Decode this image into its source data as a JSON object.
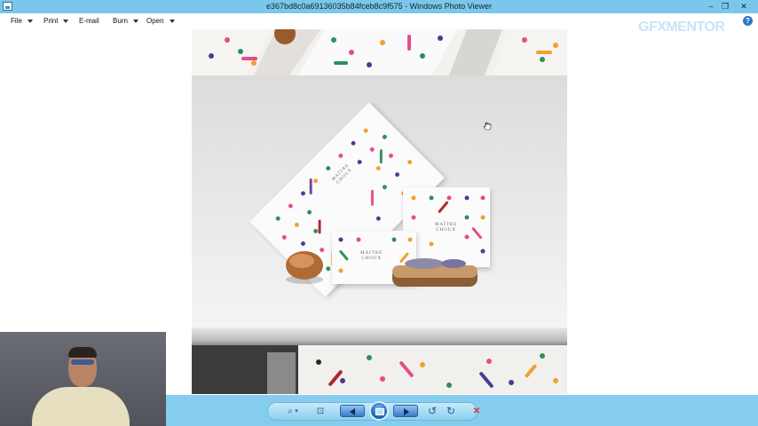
{
  "window": {
    "title": "e367bd8c0a69136035b84fceb8c9f575 - Windows Photo Viewer",
    "minimize_glyph": "–",
    "restore_glyph": "❐",
    "close_glyph": "✕"
  },
  "menu": {
    "items": [
      {
        "label": "File",
        "has_dropdown": true
      },
      {
        "label": "Print",
        "has_dropdown": true
      },
      {
        "label": "E-mail",
        "has_dropdown": false
      },
      {
        "label": "Burn",
        "has_dropdown": true
      },
      {
        "label": "Open",
        "has_dropdown": true
      }
    ],
    "help_glyph": "?"
  },
  "watermark": {
    "text": "GFXMENTOR"
  },
  "photo": {
    "box_label_1": "MAÎTRE\nCHOUX",
    "box_label_2": "MAÎTRE\nCHOUX",
    "box_label_3": "MAITRE\nCHOUX"
  },
  "toolbar": {
    "zoom_glyph": "⌕",
    "zoom_caret": "▾",
    "actual_size_glyph": "⊡",
    "rotate_ccw_glyph": "↺",
    "rotate_cw_glyph": "↻",
    "delete_glyph": "✕"
  },
  "colors": {
    "title_bar": "#7ac7eb",
    "toolbar": "#85cdee",
    "delete": "#d9302c"
  }
}
